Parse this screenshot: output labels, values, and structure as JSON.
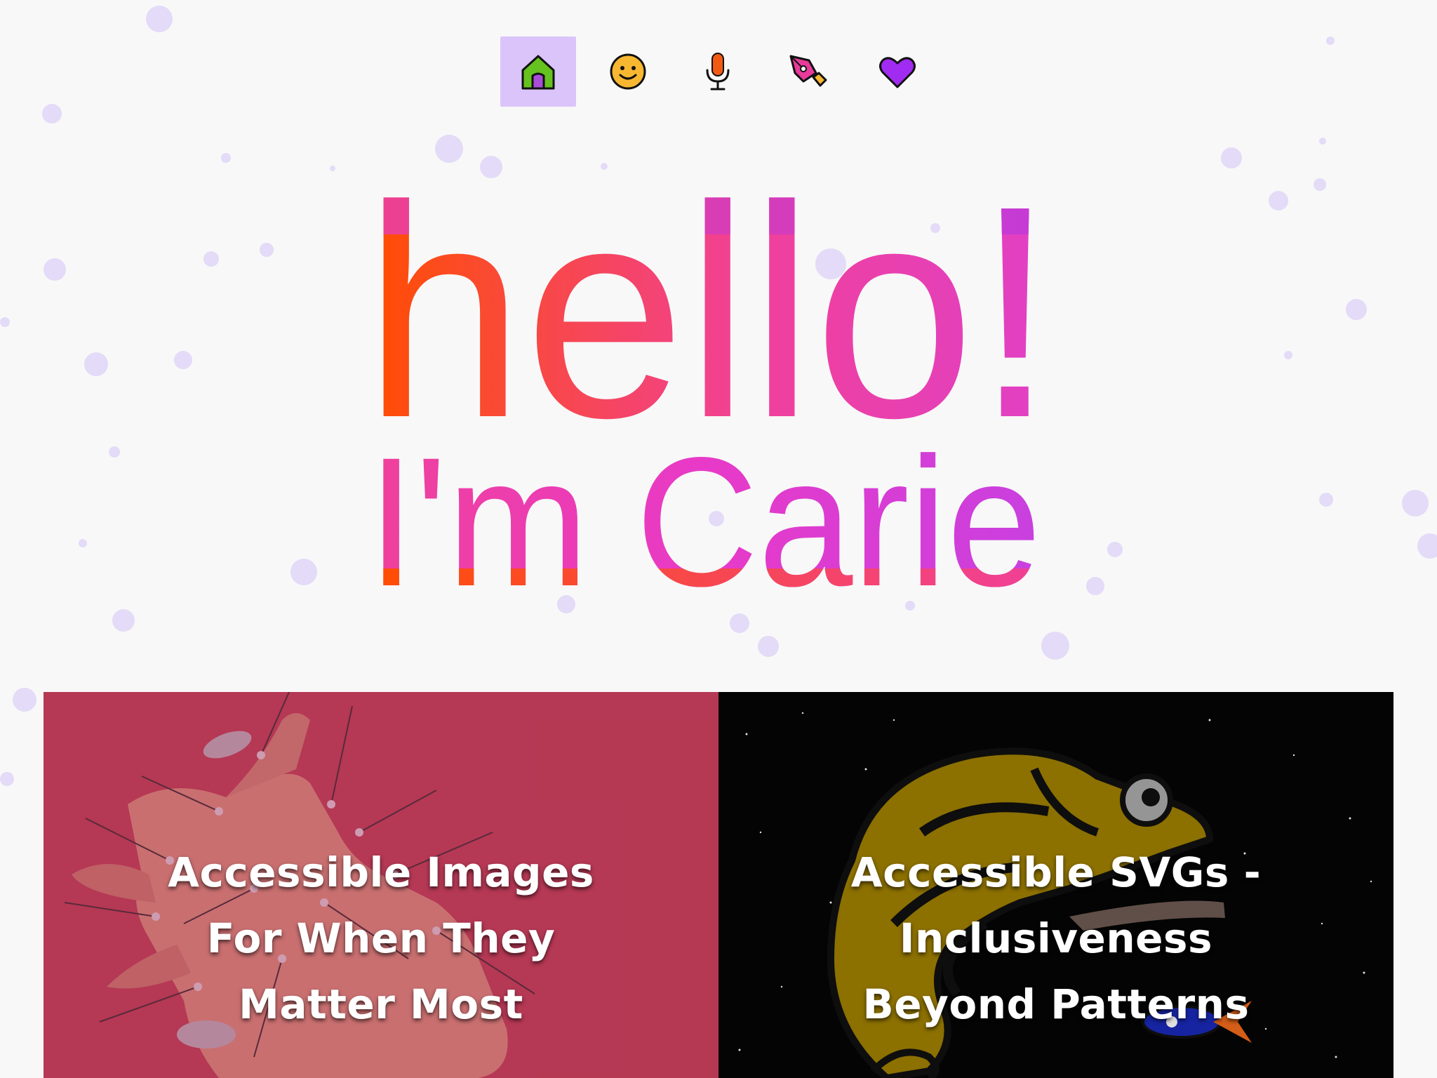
{
  "nav": {
    "items": [
      {
        "name": "home",
        "icon": "home-icon",
        "active": true
      },
      {
        "name": "about",
        "icon": "smiley-face-icon",
        "active": false
      },
      {
        "name": "talks",
        "icon": "microphone-icon",
        "active": false
      },
      {
        "name": "writing",
        "icon": "pen-nib-icon",
        "active": false
      },
      {
        "name": "favorites",
        "icon": "heart-icon",
        "active": false
      }
    ],
    "active_bg": "#dbc4fa"
  },
  "hero": {
    "greeting": "hello!",
    "intro": "I'm Carie",
    "gradient_start": "#ff4e00",
    "gradient_mid": "#f0409a",
    "gradient_end": "#c840e0"
  },
  "cards": [
    {
      "title": "Accessible Images For When They Matter Most",
      "image": "hand-with-pins-illustration"
    },
    {
      "title": "Accessible SVGs - Inclusiveness Beyond Patterns",
      "image": "chameleon-in-space-illustration"
    }
  ]
}
